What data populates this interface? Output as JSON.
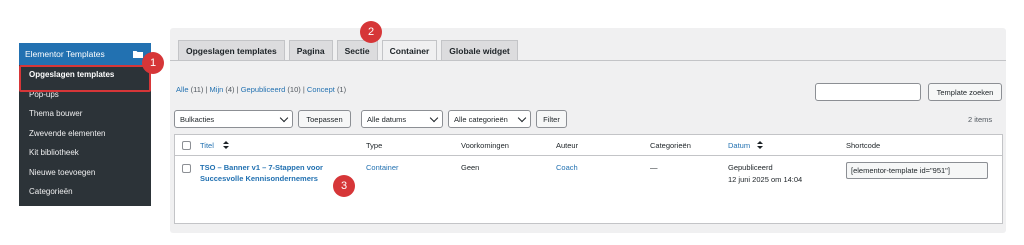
{
  "sidebar": {
    "header": "Elementor Templates",
    "header_icon": "folder-icon",
    "items": [
      {
        "label": "Opgeslagen templates",
        "active": true
      },
      {
        "label": "Pop-ups"
      },
      {
        "label": "Thema bouwer"
      },
      {
        "label": "Zwevende elementen"
      },
      {
        "label": "Kit bibliotheek"
      },
      {
        "label": "Nieuwe toevoegen"
      },
      {
        "label": "Categorieën"
      }
    ]
  },
  "tabs": [
    {
      "label": "Opgeslagen templates"
    },
    {
      "label": "Pagina"
    },
    {
      "label": "Sectie"
    },
    {
      "label": "Container",
      "active": true
    },
    {
      "label": "Globale widget"
    }
  ],
  "filters": {
    "all": "Alle",
    "all_count": "(11)",
    "mine": "Mijn",
    "mine_count": "(4)",
    "published": "Gepubliceerd",
    "published_count": "(10)",
    "draft": "Concept",
    "draft_count": "(1)",
    "sep": "|"
  },
  "search": {
    "button": "Template zoeken",
    "placeholder": ""
  },
  "toolbar": {
    "bulk_select": "Bulkacties",
    "apply": "Toepassen",
    "dates_select": "Alle datums",
    "categories_select": "Alle categorieën",
    "filter": "Filter",
    "items_count": "2 items"
  },
  "table": {
    "headers": {
      "title": "Titel",
      "type": "Type",
      "instances": "Voorkomingen",
      "author": "Auteur",
      "categories": "Categorieën",
      "date": "Datum",
      "shortcode": "Shortcode"
    },
    "rows": [
      {
        "title": "TSO – Banner v1 – 7-Stappen voor Succesvolle Kennisondernemers",
        "type": "Container",
        "instances": "Geen",
        "author": "Coach",
        "categories": "—",
        "status": "Gepubliceerd",
        "date": "12 juni 2025 om 14:04",
        "shortcode": "[elementor-template id=\"951\"]"
      }
    ]
  },
  "badges": {
    "one": "1",
    "two": "2",
    "three": "3"
  },
  "colors": {
    "accent": "#2271b1",
    "sidebar": "#2c3338",
    "badge": "#d63638"
  }
}
